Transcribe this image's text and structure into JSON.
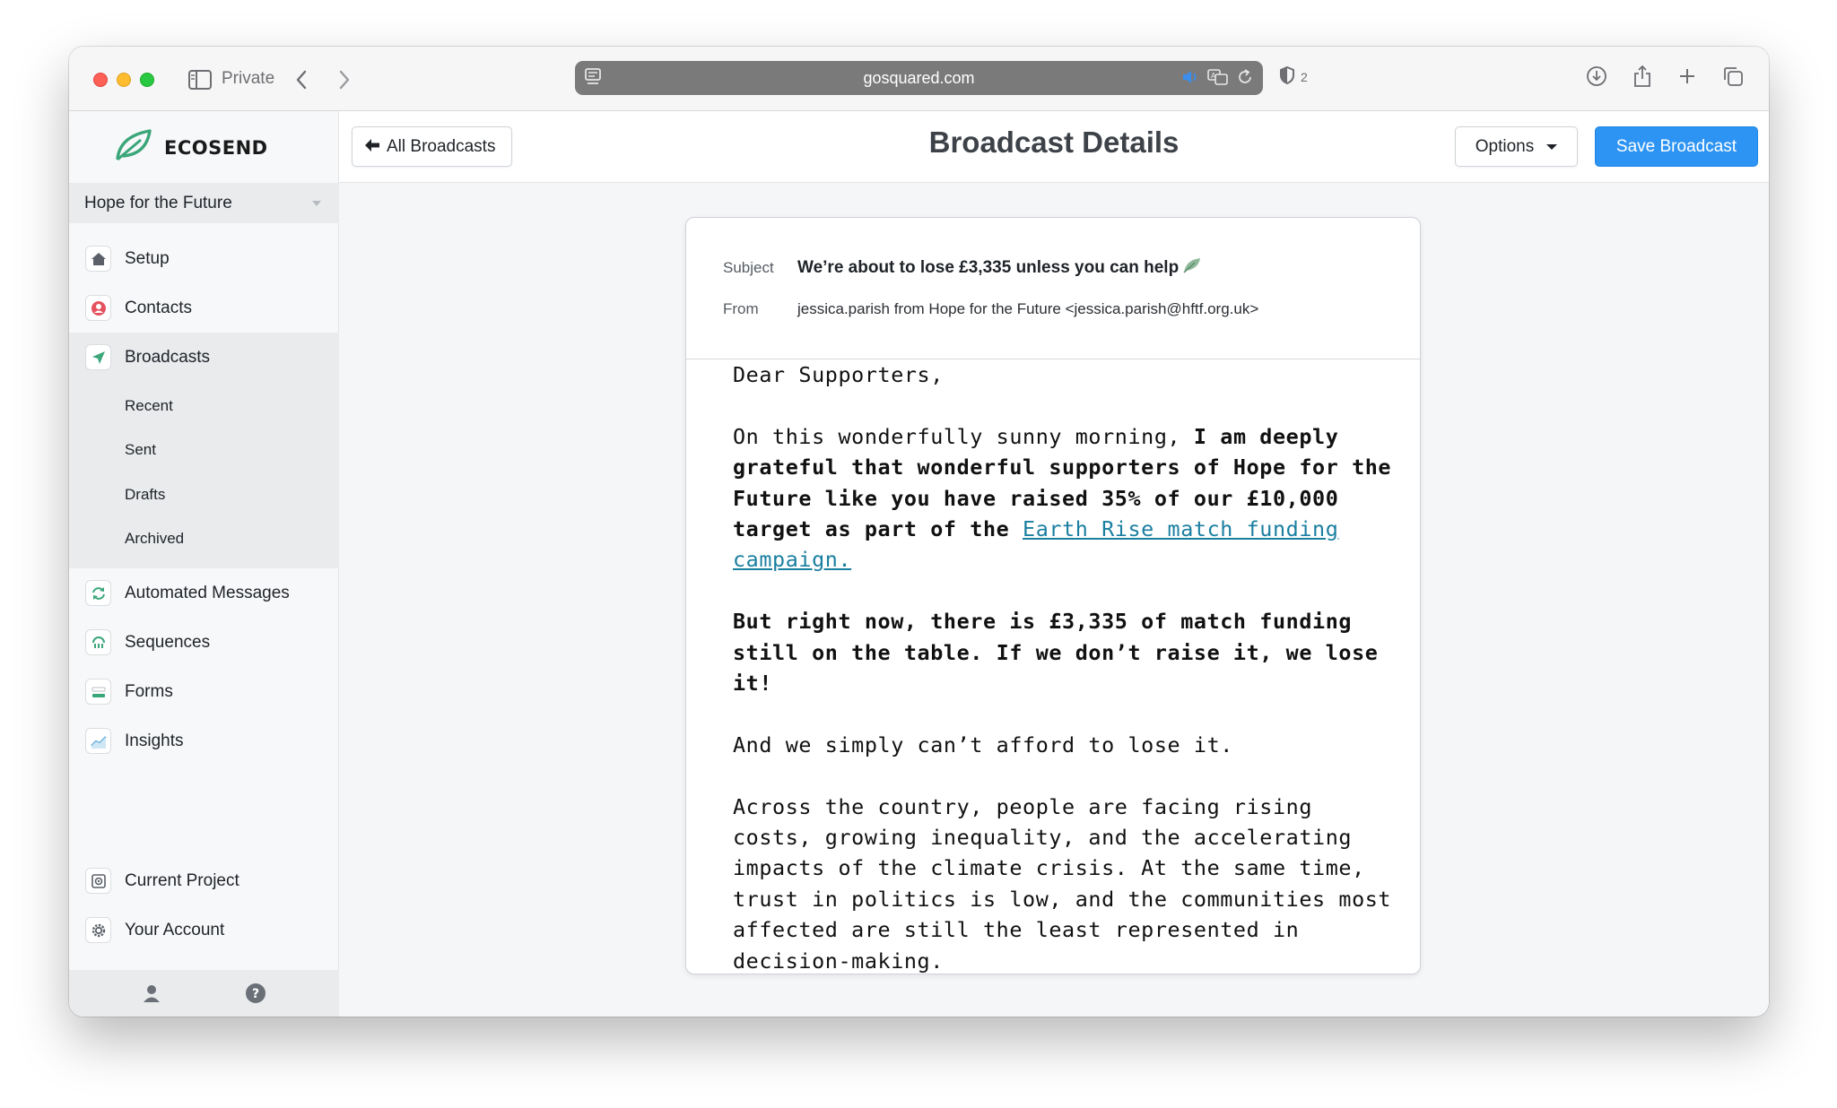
{
  "browser": {
    "private_label": "Private",
    "url": "gosquared.com",
    "tracker_count": "2"
  },
  "app": {
    "brand": "ECOSEND",
    "project": "Hope for the Future"
  },
  "sidebar": {
    "items": [
      {
        "label": "Setup",
        "icon": "home-icon"
      },
      {
        "label": "Contacts",
        "icon": "contacts-icon"
      },
      {
        "label": "Broadcasts",
        "icon": "paper-plane-icon"
      }
    ],
    "broadcast_subitems": [
      "Recent",
      "Sent",
      "Drafts",
      "Archived"
    ],
    "items_after": [
      {
        "label": "Automated Messages",
        "icon": "refresh-icon"
      },
      {
        "label": "Sequences",
        "icon": "sequence-icon"
      },
      {
        "label": "Forms",
        "icon": "form-icon"
      },
      {
        "label": "Insights",
        "icon": "chart-icon"
      }
    ],
    "bottom_items": [
      {
        "label": "Current Project",
        "icon": "project-icon"
      },
      {
        "label": "Your Account",
        "icon": "gear-icon"
      }
    ]
  },
  "toolbar": {
    "back_label": "All Broadcasts",
    "title": "Broadcast Details",
    "options_label": "Options",
    "save_label": "Save Broadcast"
  },
  "email": {
    "subject_label": "Subject",
    "subject": "We’re about to lose £3,335 unless you can help",
    "from_label": "From",
    "from": "jessica.parish from Hope for the Future <jessica.parish@hftf.org.uk>",
    "greeting": "Dear Supporters,",
    "p1_text": "On this wonderfully sunny morning, ",
    "p1_bold": "I am deeply grateful that wonderful supporters of Hope for the Future like you have raised 35% of our £10,000 target as part of the ",
    "p1_link": "Earth Rise match funding campaign. ",
    "p2": "But right now, there is £3,335 of match funding still on the table. If we don’t raise it, we lose it!",
    "p3": "And we simply can’t afford to lose it.",
    "p4": "Across the country, people are facing rising costs, growing inequality, and the accelerating impacts of the climate crisis. At the same time, trust in politics is low, and the communities most affected are still the least represented in decision-making."
  },
  "colors": {
    "accent": "#2d94f4",
    "brand_green": "#3aa67a",
    "link": "#1a7fa0"
  }
}
